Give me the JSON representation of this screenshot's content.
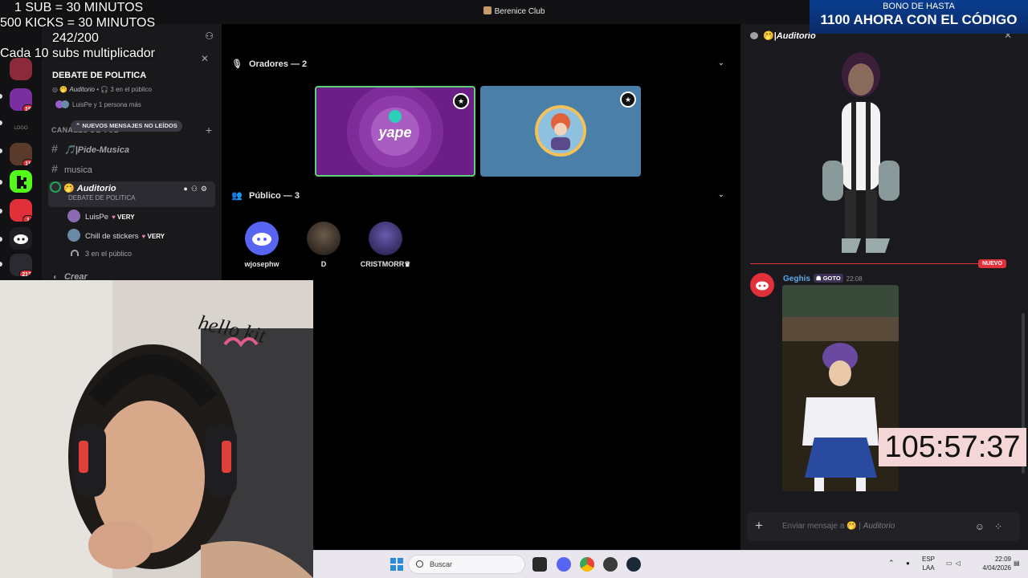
{
  "window": {
    "title": "Berenice Club"
  },
  "overlay": {
    "lines": [
      "1 SUB     = 30 MINUTOS",
      "500 KICKS = 30 MINUTOS",
      "242/200",
      "Cada 10 subs multiplicador"
    ]
  },
  "promo": {
    "line1": "BONO DE HASTA",
    "line2": "1100 AHORA CON EL CÓDIGO"
  },
  "servers": [
    {
      "badge": "19"
    },
    {
      "badge": "11"
    },
    {
      "badge": "1"
    },
    {
      "badge": "213"
    }
  ],
  "event_card": {
    "title": "DEBATE DE POLITICA",
    "stage_channel": "Auditorio",
    "audience": "3 en el público",
    "participants": "LuisPe y 1 persona más"
  },
  "sidebar": {
    "category": "CANALES DE VOZ",
    "unread_pill": "NUEVOS MENSAJES NO LEÍDOS",
    "channels": [
      {
        "name": "🎵|Pide-Musica"
      },
      {
        "name": "musica"
      },
      {
        "name": "Auditorio",
        "sub": "DEBATE DE POLITICA"
      }
    ],
    "members": [
      {
        "name": "LuisPe",
        "tag": "VERY"
      },
      {
        "name": "Chill de stickers",
        "tag": "VERY"
      }
    ],
    "audience": "3 en el público",
    "next_channel": "Crear"
  },
  "stage": {
    "speakers_header": "Oradores — 2",
    "audience_header": "Público — 3",
    "audience": [
      {
        "name": "wjosephw"
      },
      {
        "name": "D"
      },
      {
        "name": "CRISTMORR♛"
      }
    ],
    "yape_label": "yape"
  },
  "chat": {
    "header": "Auditorio",
    "new_label": "NUEVO",
    "message": {
      "author": "Geghis",
      "role": "GOTO",
      "time": "22:08"
    },
    "composer_placeholder": "Enviar mensaje a",
    "composer_channel": "Auditorio"
  },
  "timer": {
    "value": "105:57:37"
  },
  "webcam": {
    "wall_text": "hello kit"
  },
  "taskbar": {
    "search_label": "Buscar",
    "lang1": "ESP",
    "lang2": "LAA",
    "time": "22:09",
    "date": "4/04/2026"
  },
  "colors": {
    "discord_bg": "#19191c",
    "accent_red": "#e0303a",
    "stage_green": "#23a55a",
    "yape_purple": "#742284",
    "tile_blue": "#4a7fa8"
  }
}
